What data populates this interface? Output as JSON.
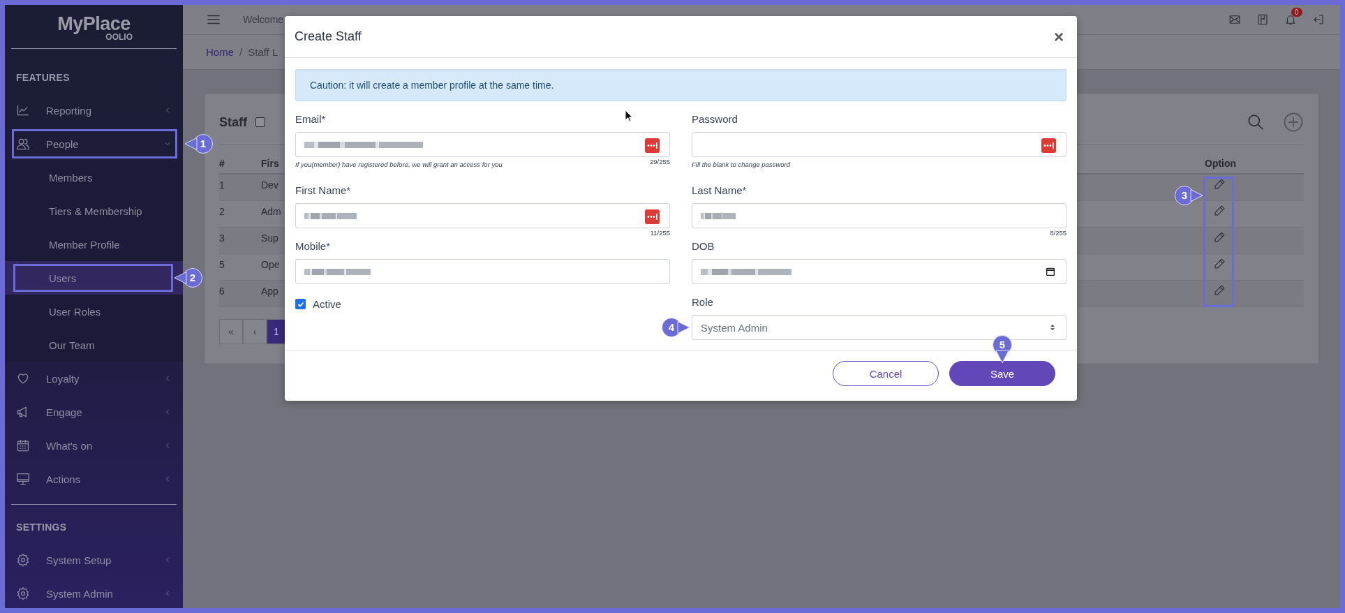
{
  "sidebar": {
    "logo": {
      "title": "MyPlace",
      "subtitle": "OOLIO"
    },
    "sections": [
      {
        "title": "FEATURES",
        "items": [
          {
            "label": "Reporting",
            "expanded": false
          },
          {
            "label": "People",
            "expanded": true,
            "callout": "1",
            "children": [
              {
                "label": "Members",
                "selected": false
              },
              {
                "label": "Tiers & Membership",
                "selected": false
              },
              {
                "label": "Member Profile",
                "selected": false
              },
              {
                "label": "Users",
                "selected": true,
                "callout": "2"
              },
              {
                "label": "User Roles",
                "selected": false
              },
              {
                "label": "Our Team",
                "selected": false
              }
            ]
          },
          {
            "label": "Loyalty",
            "expanded": false
          },
          {
            "label": "Engage",
            "expanded": false
          },
          {
            "label": "What's on",
            "expanded": false
          },
          {
            "label": "Actions",
            "expanded": false
          }
        ]
      },
      {
        "title": "SETTINGS",
        "items": [
          {
            "label": "System Setup",
            "expanded": false
          },
          {
            "label": "System Admin",
            "expanded": false
          }
        ]
      }
    ]
  },
  "topbar": {
    "greeting": "Welcome",
    "notification_count": "0"
  },
  "breadcrumb": {
    "separator": "/",
    "items": [
      "Home",
      "Staff L"
    ]
  },
  "staff_card": {
    "title": "Staff",
    "select_all_checked": false,
    "table": {
      "columns": [
        "#",
        "Firs",
        "Option"
      ],
      "option_callout": "3",
      "rows": [
        {
          "number": "1",
          "first_name": "Dev"
        },
        {
          "number": "2",
          "first_name": "Adm"
        },
        {
          "number": "3",
          "first_name": "Sup"
        },
        {
          "number": "5",
          "first_name": "Ope"
        },
        {
          "number": "6",
          "first_name": "App"
        }
      ]
    },
    "pagination": [
      {
        "label": "«",
        "selected": false
      },
      {
        "label": "‹",
        "selected": false
      },
      {
        "label": "1",
        "selected": true
      }
    ]
  },
  "modal": {
    "title": "Create Staff",
    "close": "×",
    "notice": "Caution: it will create a member profile at the same time.",
    "fields": [
      {
        "kind": "text",
        "label": "Email*",
        "obscured": true,
        "key_icon": true,
        "counter": "29/255",
        "help": "If you(member) have registered before, we will grant an access for you"
      },
      {
        "kind": "text",
        "label": "Password",
        "obscured": false,
        "key_icon": true,
        "help": "Fill the blank to change password"
      },
      {
        "kind": "text",
        "label": "First Name*",
        "obscured": true,
        "key_icon": true,
        "counter": "11/255"
      },
      {
        "kind": "text",
        "label": "Last Name*",
        "obscured": true,
        "key_icon": false,
        "counter": "8/255"
      },
      {
        "kind": "text",
        "label": "Mobile*",
        "obscured": true,
        "key_icon": false
      },
      {
        "kind": "date",
        "label": "DOB",
        "obscured": true
      },
      {
        "kind": "checkbox",
        "label": "Active",
        "checked": true
      },
      {
        "kind": "select",
        "label": "Role",
        "value": "System Admin",
        "callout": "4"
      }
    ],
    "buttons": [
      {
        "label": "Cancel",
        "kind": "secondary"
      },
      {
        "label": "Save",
        "kind": "primary",
        "callout": "5"
      }
    ]
  }
}
